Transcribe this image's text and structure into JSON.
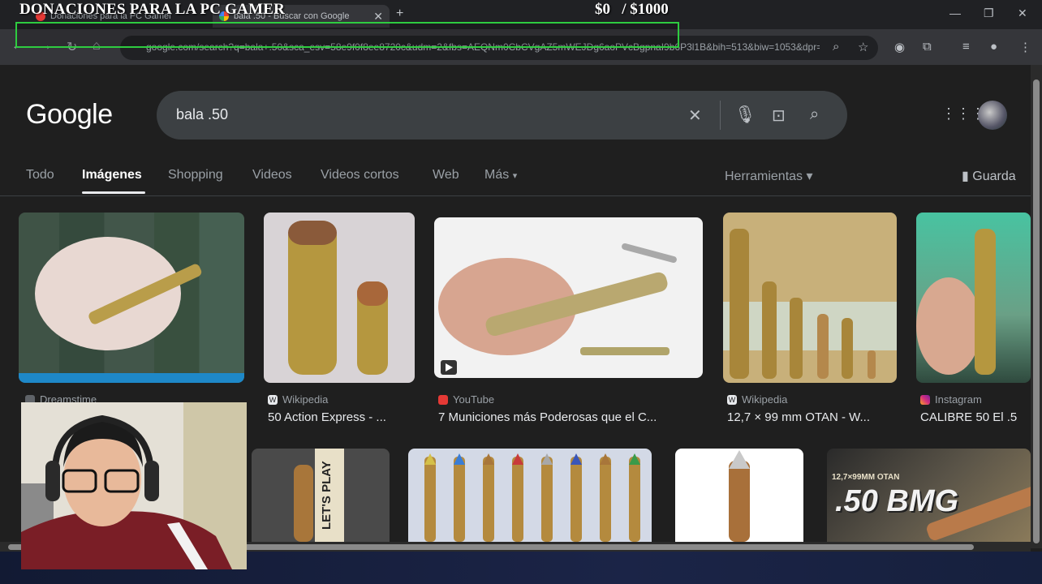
{
  "overlay": {
    "donation_title": "DONACIONES PARA LA PC GAMER",
    "donation_amount": "$0   / $1000"
  },
  "browser": {
    "tabs": [
      {
        "label": "Donaciones para la PC Gamer"
      },
      {
        "label": "bala .50 - Buscar con Google"
      }
    ],
    "new_tab": "+",
    "url": "google.com/search?q=bala+.50&sca_esv=58e9f0f8ee8720c&udm=2&fbs=AEQNm0CbCVgAZ5mWEJDg6aoPVcBgpnaI9b6P3l1B&bih=513&biw=1053&dpr=2&sa=X&ved=0ahUKEwi"
  },
  "search": {
    "logo": "Google",
    "query": "bala .50",
    "tabs": [
      "Todo",
      "Imágenes",
      "Shopping",
      "Videos",
      "Videos cortos",
      "Web",
      "Más"
    ],
    "more_suffix": "▾",
    "tools": "Herramientas ▾",
    "saved": "Guarda"
  },
  "results": [
    {
      "source": "Dreamstime",
      "title": "",
      "source_color": "#5f6368"
    },
    {
      "source": "Wikipedia",
      "title": "50 Action Express - ...",
      "source_color": "#9aa0a6"
    },
    {
      "source": "YouTube",
      "title": "7 Municiones más Poderosas que el C...",
      "source_color": "#e53935"
    },
    {
      "source": "Wikipedia",
      "title": "12,7 × 99 mm OTAN - W...",
      "source_color": "#9aa0a6"
    },
    {
      "source": "Instagram",
      "title": "CALIBRE 50 El .5",
      "source_color": "#d6307c"
    }
  ],
  "row2_texts": {
    "lets_play": "LET'S PLAY",
    "bmg_caption": ".50 BMG",
    "bmg_sub": "12,7×99MM OTAN"
  }
}
